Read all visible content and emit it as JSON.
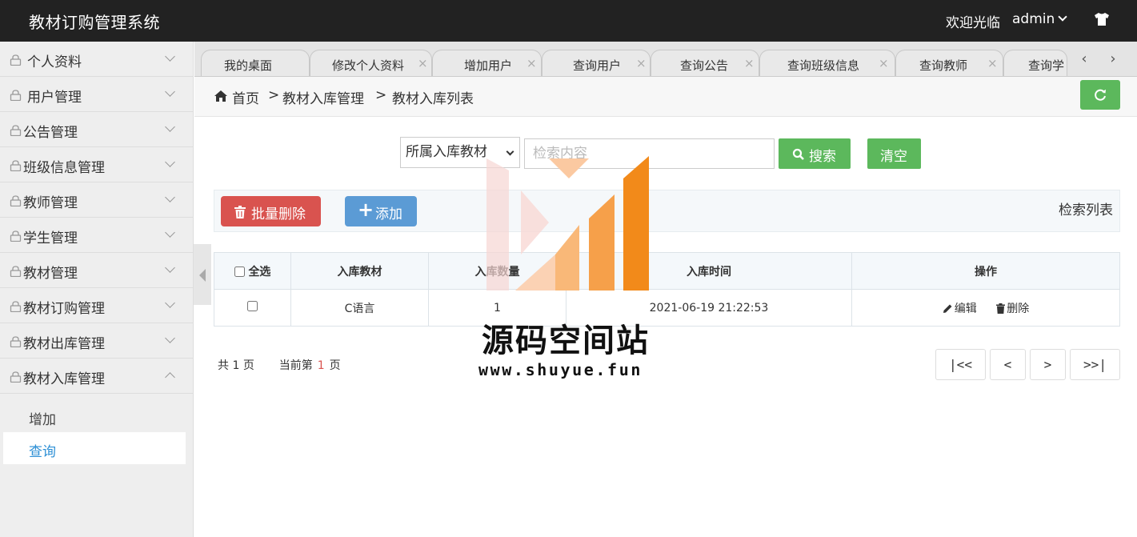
{
  "header": {
    "app_title": "教材订购管理系统",
    "welcome": "欢迎光临",
    "username": "admin"
  },
  "sidebar": {
    "items": [
      {
        "label": "个人资料"
      },
      {
        "label": "用户管理"
      },
      {
        "label": "公告管理"
      },
      {
        "label": "班级信息管理"
      },
      {
        "label": "教师管理"
      },
      {
        "label": "学生管理"
      },
      {
        "label": "教材管理"
      },
      {
        "label": "教材订购管理"
      },
      {
        "label": "教材出库管理"
      },
      {
        "label": "教材入库管理",
        "expanded": true
      }
    ],
    "submenu": [
      {
        "label": "增加"
      },
      {
        "label": "查询",
        "active": true
      }
    ]
  },
  "tabs": [
    {
      "label": "我的桌面"
    },
    {
      "label": "修改个人资料"
    },
    {
      "label": "增加用户"
    },
    {
      "label": "查询用户"
    },
    {
      "label": "查询公告"
    },
    {
      "label": "查询班级信息"
    },
    {
      "label": "查询教师"
    },
    {
      "label": "查询学"
    }
  ],
  "tab_close": "×",
  "breadcrumb": {
    "home": "首页",
    "sep": ">",
    "level2": "教材入库管理",
    "level3": "教材入库列表"
  },
  "search": {
    "select_value": "所属入库教材",
    "placeholder": "检索内容",
    "search_label": "搜索",
    "clear_label": "清空"
  },
  "toolbar": {
    "batch_delete_label": "批量删除",
    "add_label": "添加",
    "list_title": "检索列表"
  },
  "table": {
    "select_all_label": "全选",
    "headers": [
      "入库教材",
      "入库数量",
      "入库时间",
      "操作"
    ],
    "rows": [
      {
        "material": "C语言",
        "quantity": "1",
        "time": "2021-06-19 21:22:53"
      }
    ],
    "edit_label": "编辑",
    "delete_label": "删除"
  },
  "pagination": {
    "total_prefix": "共",
    "total_pages": "1",
    "total_suffix": "页",
    "current_prefix": "当前第",
    "current_page": "1",
    "current_suffix": "页",
    "first": "|<<",
    "prev": "<",
    "next": ">",
    "last": ">>|"
  },
  "watermark": {
    "title": "源码空间站",
    "url": "www.shuyue.fun"
  },
  "colors": {
    "header_bg": "#222222",
    "success": "#5cb85c",
    "danger": "#d9534f",
    "primary": "#5b9bd5",
    "active_link": "#2d8fd5",
    "watermark_orange": "#f28a1a"
  }
}
